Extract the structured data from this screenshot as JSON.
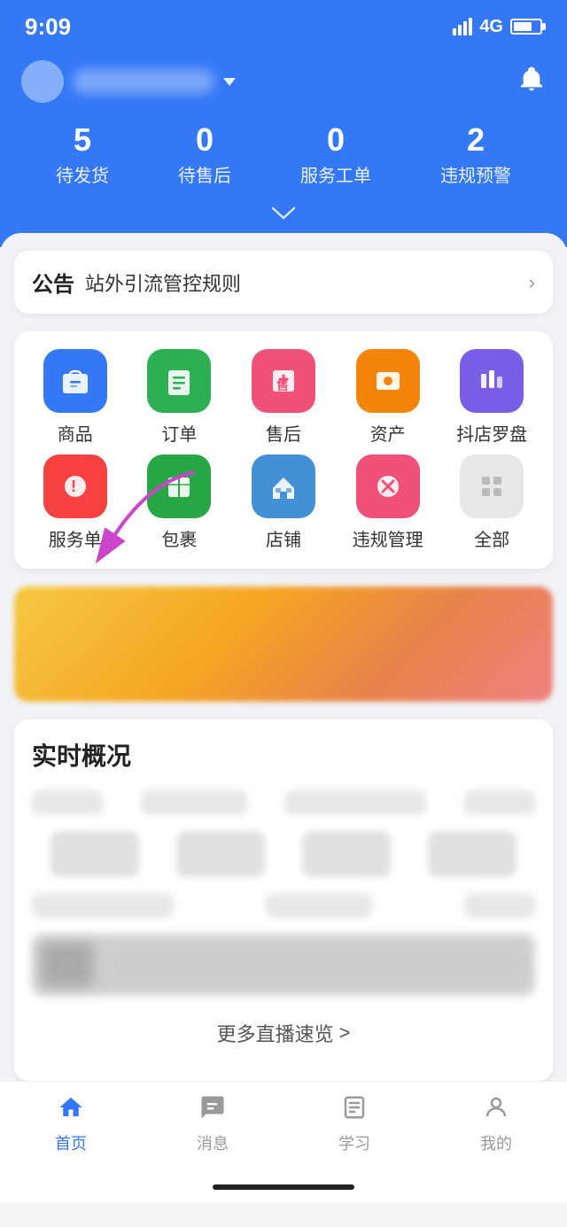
{
  "statusBar": {
    "time": "9:09",
    "signal": "4G"
  },
  "header": {
    "stats": [
      {
        "key": "waiting_ship",
        "num": "5",
        "label": "待发货"
      },
      {
        "key": "after_sale",
        "num": "0",
        "label": "待售后"
      },
      {
        "key": "service_order",
        "num": "0",
        "label": "服务工单"
      },
      {
        "key": "violation",
        "num": "2",
        "label": "违规预警"
      }
    ]
  },
  "announcement": {
    "label": "公告",
    "text": "站外引流管控规则"
  },
  "menuItems": {
    "row1": [
      {
        "id": "goods",
        "label": "商品",
        "iconColor": "blue"
      },
      {
        "id": "orders",
        "label": "订单",
        "iconColor": "green"
      },
      {
        "id": "aftersale",
        "label": "售后",
        "iconColor": "pink"
      },
      {
        "id": "assets",
        "label": "资产",
        "iconColor": "orange"
      },
      {
        "id": "compass",
        "label": "抖店罗盘",
        "iconColor": "purple"
      }
    ],
    "row2": [
      {
        "id": "service",
        "label": "服务单",
        "iconColor": "red"
      },
      {
        "id": "package",
        "label": "包裹",
        "iconColor": "darkgreen"
      },
      {
        "id": "store",
        "label": "店铺",
        "iconColor": "bluelight"
      },
      {
        "id": "violation_mgmt",
        "label": "违规管理",
        "iconColor": "pinkred"
      },
      {
        "id": "all",
        "label": "全部",
        "iconColor": "gray"
      }
    ]
  },
  "realtime": {
    "title": "实时概况"
  },
  "moreLive": {
    "text": "更多直播速览",
    "arrow": ">"
  },
  "bottomNav": [
    {
      "id": "home",
      "label": "首页",
      "active": true
    },
    {
      "id": "messages",
      "label": "消息",
      "active": false
    },
    {
      "id": "learn",
      "label": "学习",
      "active": false
    },
    {
      "id": "mine",
      "label": "我的",
      "active": false
    }
  ]
}
